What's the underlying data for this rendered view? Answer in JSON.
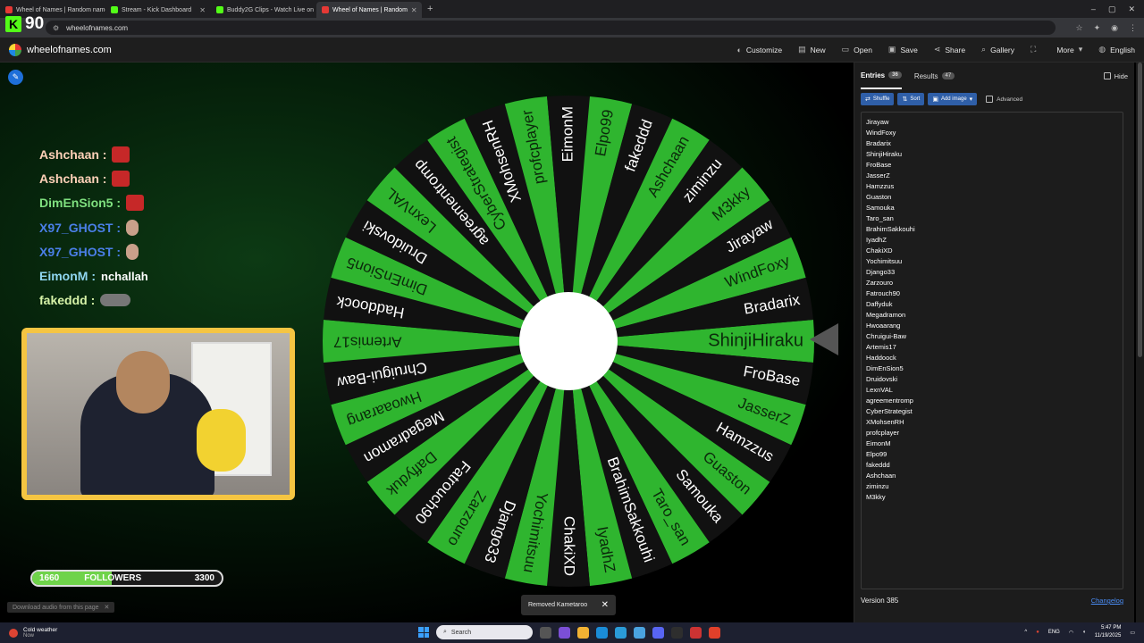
{
  "browser": {
    "tabs": [
      {
        "title": "Wheel of Names | Random name",
        "color": "#e53935",
        "active": false
      },
      {
        "title": "Stream - Kick Dashboard",
        "color": "#53fc18",
        "active": false
      },
      {
        "title": "Buddy2G Clips - Watch Live on",
        "color": "#53fc18",
        "active": false
      },
      {
        "title": "Wheel of Names | Random",
        "color": "#e53935",
        "active": true
      }
    ],
    "url": "wheelofnames.com"
  },
  "app": {
    "brand": "wheelofnames.com",
    "menu": [
      {
        "label": "Customize",
        "icon": "palette-icon",
        "glyph": "◐"
      },
      {
        "label": "New",
        "icon": "new-file-icon",
        "glyph": "▤"
      },
      {
        "label": "Open",
        "icon": "folder-icon",
        "glyph": "▭"
      },
      {
        "label": "Save",
        "icon": "save-icon",
        "glyph": "▣"
      },
      {
        "label": "Share",
        "icon": "share-icon",
        "glyph": "⋖"
      },
      {
        "label": "Gallery",
        "icon": "search-icon",
        "glyph": "⌕"
      },
      {
        "label": "",
        "icon": "fullscreen-icon",
        "glyph": "⛶"
      },
      {
        "label": "More",
        "icon": "chevron-down-icon",
        "glyph": "▾"
      },
      {
        "label": "English",
        "icon": "globe-icon",
        "glyph": "◍"
      }
    ]
  },
  "overlay": {
    "kick_count": "90",
    "chat": [
      {
        "user": "Ashchaan :",
        "color": "#ffd1b8",
        "emote": "emote-red",
        "msg": ""
      },
      {
        "user": "Ashchaan :",
        "color": "#ffd1b8",
        "emote": "emote-red",
        "msg": ""
      },
      {
        "user": "DimEnSion5 :",
        "color": "#7fe07f",
        "emote": "emote-red",
        "msg": ""
      },
      {
        "user": "X97_GHOST :",
        "color": "#4a7fe8",
        "emote": "emote-finger",
        "msg": ""
      },
      {
        "user": "X97_GHOST :",
        "color": "#4a7fe8",
        "emote": "emote-finger",
        "msg": ""
      },
      {
        "user": "EimonM :",
        "color": "#8fd6f0",
        "emote": "",
        "msg": "nchallah"
      },
      {
        "user": "fakeddd :",
        "color": "#d7f3a8",
        "emote": "emote-gray",
        "msg": ""
      }
    ],
    "followers": {
      "min": "1660",
      "label": "FOLLOWERS",
      "max": "3300",
      "progress": 0.42
    },
    "download_audio": "Download audio from this page"
  },
  "wheel": {
    "colors": [
      "#2fb52f",
      "#111111"
    ],
    "segments": [
      "ShinjiHiraku",
      "FroBase",
      "JasserZ",
      "Hamzzus",
      "Guaston",
      "Samouka",
      "Taro_san",
      "BrahimSakkouhi",
      "IyadhZ",
      "ChakiXD",
      "Yochimitsuu",
      "Django33",
      "Zarzouro",
      "Fatrouch90",
      "Daffyduk",
      "Megadramon",
      "Hwoaarang",
      "Chruigui-Baw",
      "Artemis17",
      "Haddoock",
      "DimEnSion5",
      "Druidovski",
      "LexnVAL",
      "agreementromp",
      "CyberStrategist",
      "XMohsenRH",
      "profcplayer",
      "EimonM",
      "Elpo99",
      "fakeddd",
      "Ashchaan",
      "ziminzu",
      "M3kky",
      "Jirayaw",
      "WindFoxy",
      "Bradarix"
    ]
  },
  "toast": {
    "text": "Removed Kametaroo"
  },
  "panel": {
    "tab_entries": "Entries",
    "entries_count": "36",
    "tab_results": "Results",
    "results_count": "47",
    "hide": "Hide",
    "shuffle": "Shuffle",
    "sort": "Sort",
    "add_image": "Add image",
    "advanced": "Advanced",
    "entries": [
      "Jirayaw",
      "WindFoxy",
      "Bradarix",
      "ShinjiHiraku",
      "FroBase",
      "JasserZ",
      "Hamzzus",
      "Guaston",
      "Samouka",
      "Taro_san",
      "BrahimSakkouhi",
      "IyadhZ",
      "ChakiXD",
      "Yochimitsuu",
      "Django33",
      "Zarzouro",
      "Fatrouch90",
      "Daffyduk",
      "Megadramon",
      "Hwoaarang",
      "Chruigui-Baw",
      "Artemis17",
      "Haddoock",
      "DimEnSion5",
      "Druidovski",
      "LexnVAL",
      "agreementromp",
      "CyberStrategist",
      "XMohsenRH",
      "profcplayer",
      "EimonM",
      "Elpo99",
      "fakeddd",
      "Ashchaan",
      "ziminzu",
      "M3kky"
    ],
    "version": "Version 385",
    "changelog": "Changelog"
  },
  "taskbar": {
    "weather": "Cold weather",
    "weather_sub": "Now",
    "search": "Search",
    "lang": "ENG",
    "time": "5:47 PM",
    "date": "11/19/2025"
  }
}
